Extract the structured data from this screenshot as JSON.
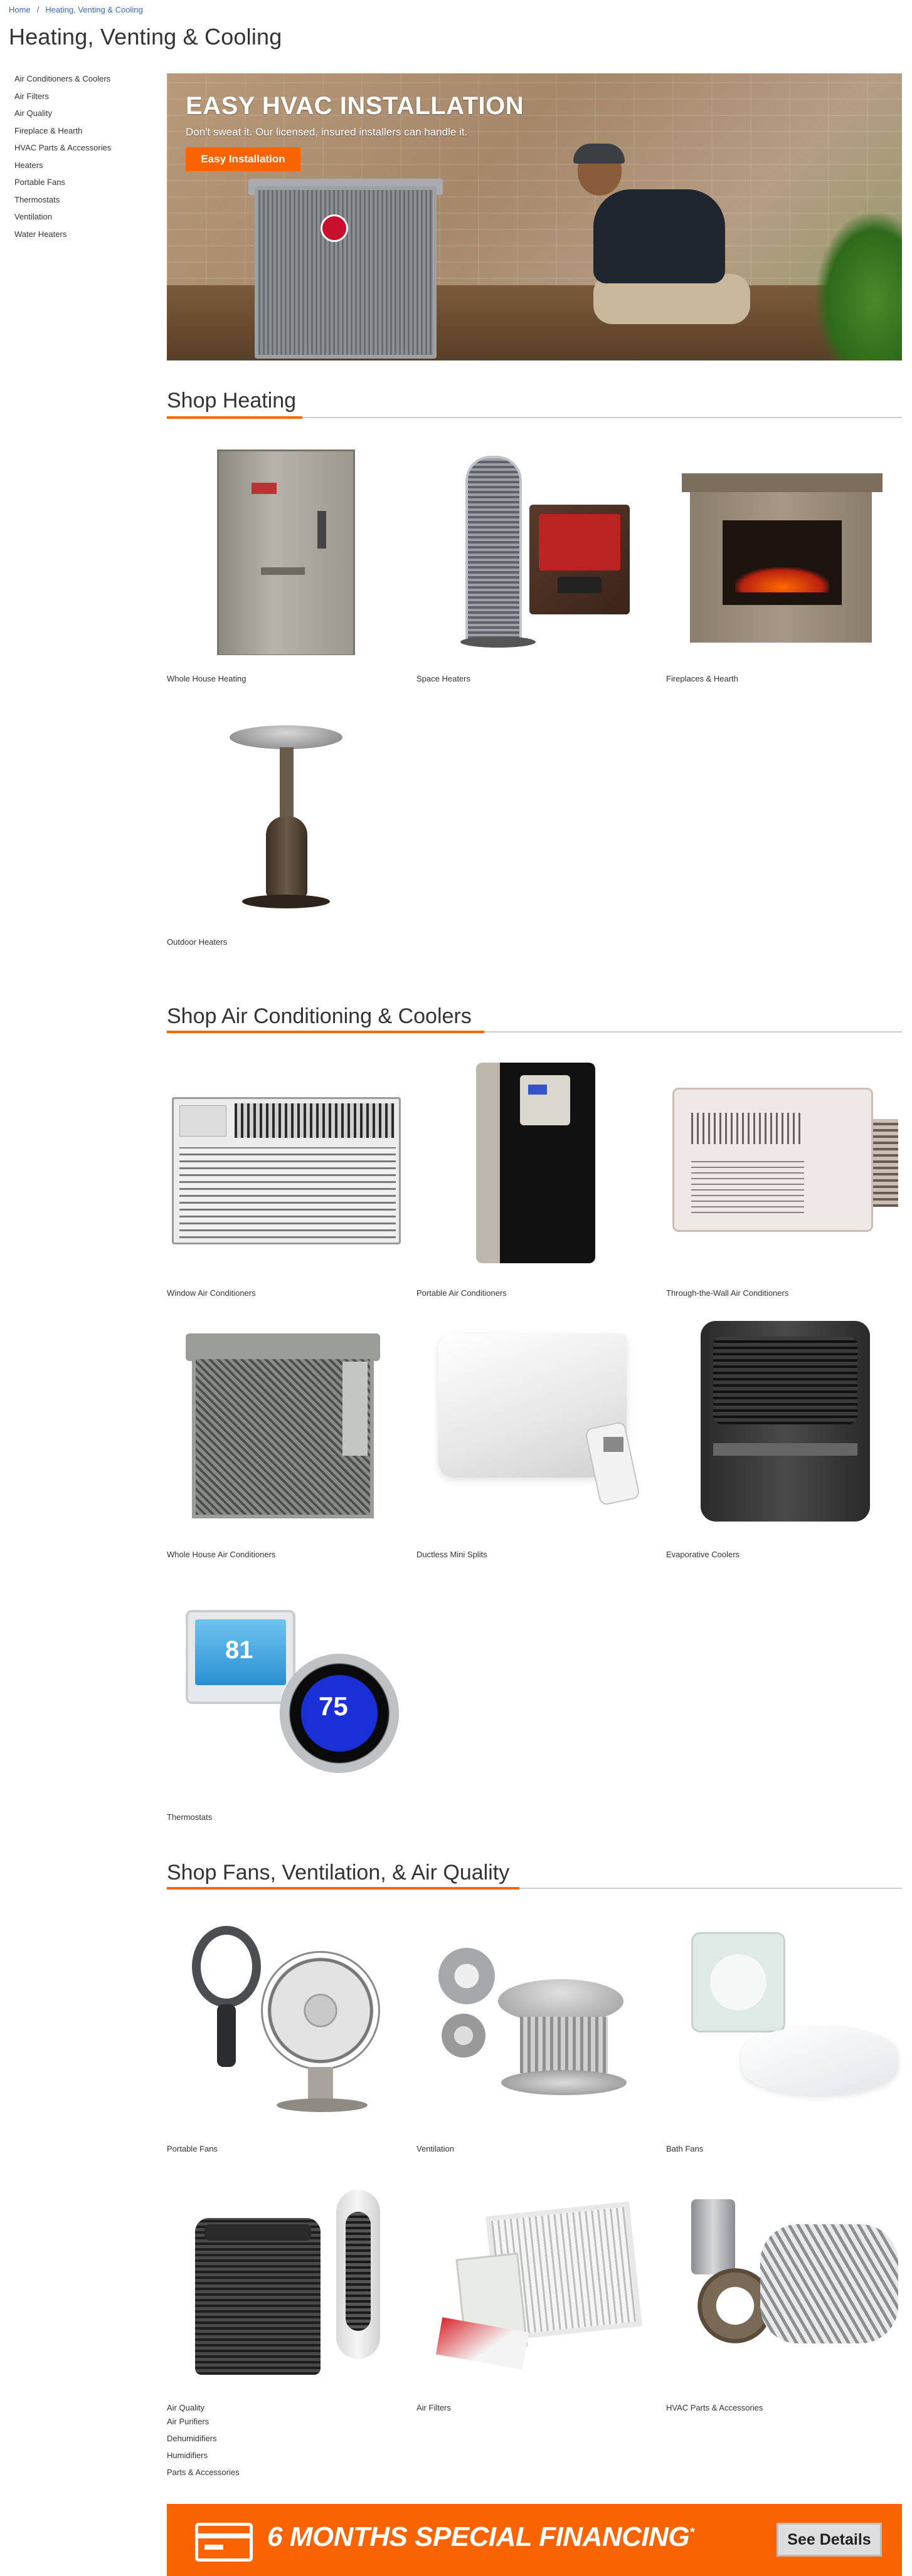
{
  "breadcrumb": {
    "home": "Home",
    "separator": "/",
    "current": "Heating, Venting & Cooling"
  },
  "page": {
    "title": "Heating, Venting & Cooling"
  },
  "sidebar": {
    "items": [
      {
        "label": "Air Conditioners & Coolers"
      },
      {
        "label": "Air Filters"
      },
      {
        "label": "Air Quality"
      },
      {
        "label": "Fireplace & Hearth"
      },
      {
        "label": "HVAC Parts & Accessories"
      },
      {
        "label": "Heaters"
      },
      {
        "label": "Portable Fans"
      },
      {
        "label": "Thermostats"
      },
      {
        "label": "Ventilation"
      },
      {
        "label": "Water Heaters"
      }
    ]
  },
  "hero": {
    "title": "EASY HVAC INSTALLATION",
    "subtitle": "Don't sweat it. Our licensed, insured installers can handle it.",
    "cta": "Easy Installation"
  },
  "sections": {
    "heating": {
      "title": "Shop Heating",
      "tiles": [
        {
          "label": "Whole House Heating"
        },
        {
          "label": "Space Heaters"
        },
        {
          "label": "Fireplaces & Hearth"
        },
        {
          "label": "Outdoor Heaters"
        }
      ]
    },
    "cooling": {
      "title": "Shop Air Conditioning & Coolers",
      "tiles": [
        {
          "label": "Window Air Conditioners"
        },
        {
          "label": "Portable Air Conditioners"
        },
        {
          "label": "Through-the-Wall Air Conditioners"
        },
        {
          "label": "Whole House Air Conditioners"
        },
        {
          "label": "Ductless Mini Splits"
        },
        {
          "label": "Evaporative Coolers"
        },
        {
          "label": "Thermostats",
          "display_a": "81",
          "display_b": "75"
        }
      ]
    },
    "fans": {
      "title": "Shop Fans, Ventilation, & Air Quality",
      "tiles": [
        {
          "label": "Portable Fans"
        },
        {
          "label": "Ventilation"
        },
        {
          "label": "Bath Fans"
        },
        {
          "label": "Air Quality"
        },
        {
          "label": "Air Filters"
        },
        {
          "label": "HVAC Parts & Accessories"
        }
      ],
      "sublinks": [
        {
          "label": "Air Purifiers"
        },
        {
          "label": "Dehumidifiers"
        },
        {
          "label": "Humidifiers"
        },
        {
          "label": "Parts & Accessories"
        }
      ]
    }
  },
  "promo": {
    "text": "6 MONTHS SPECIAL FINANCING",
    "mark": "*",
    "button": "See Details"
  },
  "colors": {
    "brand_orange": "#f96302",
    "link_blue": "#3366cc"
  }
}
